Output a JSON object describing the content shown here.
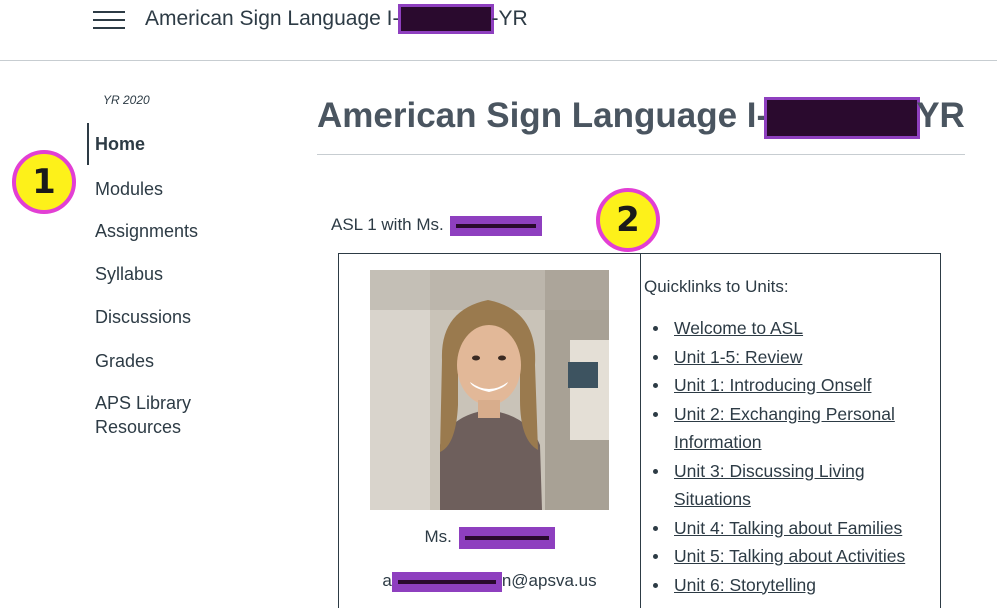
{
  "header": {
    "title_prefix": "American Sign Language I-",
    "title_suffix": "-YR",
    "menu_icon": "hamburger-menu-icon"
  },
  "sidebar": {
    "term": "YR 2020",
    "items": [
      {
        "label": "Home",
        "active": true
      },
      {
        "label": "Modules"
      },
      {
        "label": "Assignments"
      },
      {
        "label": "Syllabus"
      },
      {
        "label": "Discussions"
      },
      {
        "label": "Grades"
      },
      {
        "label": "APS Library Resources"
      }
    ]
  },
  "annotations": {
    "badge_1": "1",
    "badge_2": "2",
    "badge_fill": "#fdf11a",
    "badge_border": "#e23fd4",
    "redaction_color": "#8e3fbf"
  },
  "main": {
    "title_prefix": "American Sign Language I-",
    "title_suffix": "YR",
    "intro": "ASL 1 with Ms.",
    "teacher": {
      "name_prefix": "Ms.",
      "email_prefix": "a",
      "email_suffix": "n@apsva.us"
    },
    "quicklinks": {
      "heading": "Quicklinks to Units:",
      "links": [
        "Welcome to ASL",
        "Unit 1-5: Review",
        "Unit 1: Introducing Onself",
        "Unit 2: Exchanging Personal Information",
        "Unit 3: Discussing Living Situations",
        "Unit 4: Talking about Families",
        "Unit 5: Talking about Activities",
        "Unit 6: Storytelling"
      ]
    }
  }
}
